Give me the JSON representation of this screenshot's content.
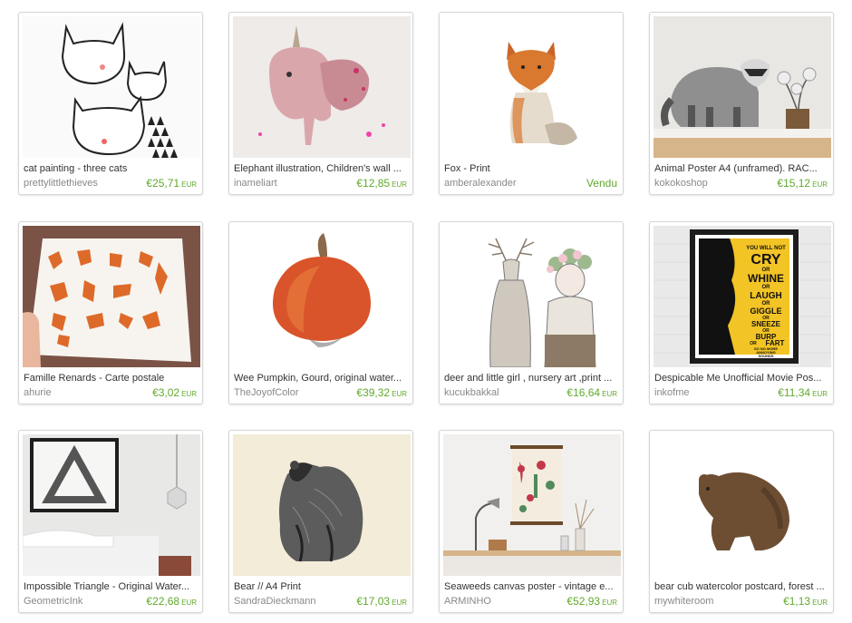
{
  "listings": [
    {
      "title": "cat painting - three cats",
      "shop": "prettylittlethieves",
      "price": "€25,71",
      "currency": "EUR",
      "image": "three-cats-illustration"
    },
    {
      "title": "Elephant illustration, Children's wall ...",
      "shop": "inameliart",
      "price": "€12,85",
      "currency": "EUR",
      "image": "pink-elephant-illustration"
    },
    {
      "title": "Fox - Print",
      "shop": "amberalexander",
      "price": "Vendu",
      "currency": "",
      "image": "fox-watercolor"
    },
    {
      "title": "Animal Poster A4 (unframed). RAC...",
      "shop": "kokokoshop",
      "price": "€15,12",
      "currency": "EUR",
      "image": "raccoon-poster-photo"
    },
    {
      "title": "Famille Renards - Carte postale",
      "shop": "ahurie",
      "price": "€3,02",
      "currency": "EUR",
      "image": "fox-family-postcard"
    },
    {
      "title": "Wee Pumpkin, Gourd, original water...",
      "shop": "TheJoyofColor",
      "price": "€39,32",
      "currency": "EUR",
      "image": "pumpkin-watercolor"
    },
    {
      "title": "deer and little girl , nursery art ,print ...",
      "shop": "kucukbakkal",
      "price": "€16,64",
      "currency": "EUR",
      "image": "deer-and-girl-illustration"
    },
    {
      "title": "Despicable Me Unofficial Movie Pos...",
      "shop": "inkofme",
      "price": "€11,34",
      "currency": "EUR",
      "image": "typography-poster-yellow"
    },
    {
      "title": "Impossible Triangle - Original Water...",
      "shop": "GeometricInk",
      "price": "€22,68",
      "currency": "EUR",
      "image": "impossible-triangle-room"
    },
    {
      "title": "Bear // A4 Print",
      "shop": "SandraDieckmann",
      "price": "€17,03",
      "currency": "EUR",
      "image": "bear-ink-drawing"
    },
    {
      "title": "Seaweeds canvas poster - vintage e...",
      "shop": "ARMINHO",
      "price": "€52,93",
      "currency": "EUR",
      "image": "seaweed-poster-desk"
    },
    {
      "title": "bear cub watercolor postcard, forest ...",
      "shop": "mywhiteroom",
      "price": "€1,13",
      "currency": "EUR",
      "image": "bear-cub-watercolor"
    }
  ],
  "poster_text": [
    "YOU WILL NOT",
    "CRY",
    "OR",
    "WHINE",
    "OR",
    "LAUGH",
    "OR",
    "GIGGLE",
    "OR",
    "SNEEZE",
    "OR",
    "BURP",
    "OR",
    "FART",
    "SO NO MORE",
    "ANNOYING",
    "SOUNDS"
  ]
}
